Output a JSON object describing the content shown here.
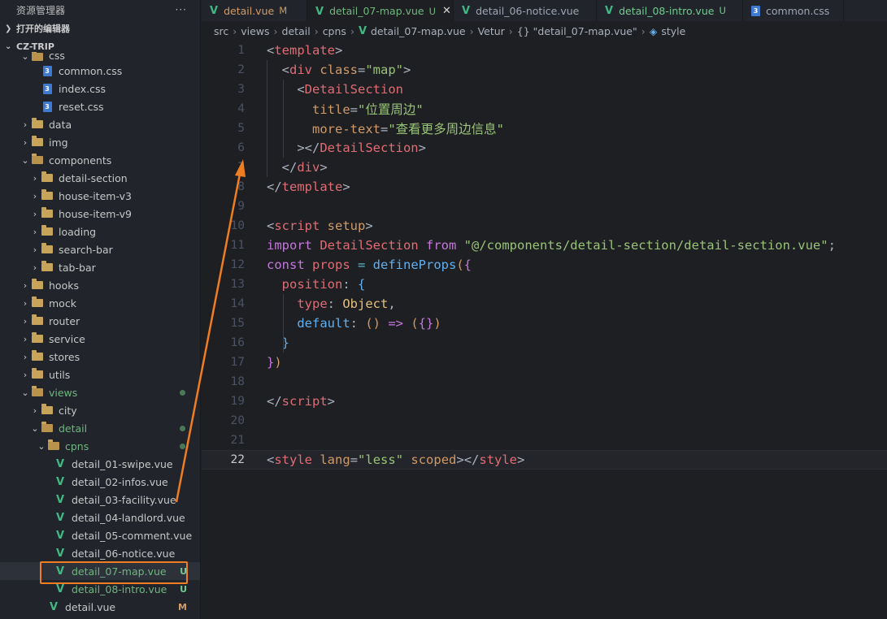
{
  "sidebar": {
    "title": "资源管理器",
    "more": "···",
    "open_editors": "打开的编辑器",
    "project": "CZ-TRIP",
    "tree": [
      {
        "label": "css",
        "kind": "folder-open",
        "depth": 1,
        "partial": true
      },
      {
        "label": "common.css",
        "kind": "css",
        "depth": 2
      },
      {
        "label": "index.css",
        "kind": "css",
        "depth": 2
      },
      {
        "label": "reset.css",
        "kind": "css",
        "depth": 2
      },
      {
        "label": "data",
        "kind": "folder",
        "depth": 1
      },
      {
        "label": "img",
        "kind": "folder",
        "depth": 1
      },
      {
        "label": "components",
        "kind": "folder-open",
        "depth": 1
      },
      {
        "label": "detail-section",
        "kind": "folder",
        "depth": 2
      },
      {
        "label": "house-item-v3",
        "kind": "folder",
        "depth": 2
      },
      {
        "label": "house-item-v9",
        "kind": "folder",
        "depth": 2
      },
      {
        "label": "loading",
        "kind": "folder",
        "depth": 2
      },
      {
        "label": "search-bar",
        "kind": "folder",
        "depth": 2
      },
      {
        "label": "tab-bar",
        "kind": "folder",
        "depth": 2
      },
      {
        "label": "hooks",
        "kind": "folder",
        "depth": 1
      },
      {
        "label": "mock",
        "kind": "folder",
        "depth": 1
      },
      {
        "label": "router",
        "kind": "folder",
        "depth": 1
      },
      {
        "label": "service",
        "kind": "folder",
        "depth": 1
      },
      {
        "label": "stores",
        "kind": "folder",
        "depth": 1
      },
      {
        "label": "utils",
        "kind": "folder",
        "depth": 1
      },
      {
        "label": "views",
        "kind": "folder-open",
        "depth": 1,
        "dot": true,
        "green": true
      },
      {
        "label": "city",
        "kind": "folder",
        "depth": 2
      },
      {
        "label": "detail",
        "kind": "folder-open",
        "depth": 2,
        "dot": true,
        "green": true
      },
      {
        "label": "cpns",
        "kind": "folder-open",
        "depth": 3,
        "dot": true,
        "green": true
      },
      {
        "label": "detail_01-swipe.vue",
        "kind": "vue",
        "depth": 4
      },
      {
        "label": "detail_02-infos.vue",
        "kind": "vue",
        "depth": 4
      },
      {
        "label": "detail_03-facility.vue",
        "kind": "vue",
        "depth": 4
      },
      {
        "label": "detail_04-landlord.vue",
        "kind": "vue",
        "depth": 4
      },
      {
        "label": "detail_05-comment.vue",
        "kind": "vue",
        "depth": 4
      },
      {
        "label": "detail_06-notice.vue",
        "kind": "vue",
        "depth": 4
      },
      {
        "label": "detail_07-map.vue",
        "kind": "vue",
        "depth": 4,
        "badge": "U",
        "green": true,
        "selected": true
      },
      {
        "label": "detail_08-intro.vue",
        "kind": "vue",
        "depth": 4,
        "badge": "U",
        "green": true
      },
      {
        "label": "detail.vue",
        "kind": "vue",
        "depth": 3,
        "badge": "M",
        "modified": true
      }
    ]
  },
  "tabs": [
    {
      "label": "detail.vue",
      "badge": "M",
      "kind": "vue",
      "state": "mod"
    },
    {
      "label": "detail_07-map.vue",
      "badge": "U",
      "kind": "vue",
      "state": "active",
      "close": "✕"
    },
    {
      "label": "detail_06-notice.vue",
      "badge": "",
      "kind": "vue",
      "state": "normal"
    },
    {
      "label": "detail_08-intro.vue",
      "badge": "U",
      "kind": "vue",
      "state": "untracked"
    },
    {
      "label": "common.css",
      "badge": "",
      "kind": "css",
      "state": "normal"
    }
  ],
  "breadcrumb": [
    "src",
    "views",
    "detail",
    "cpns",
    "detail_07-map.vue",
    "Vetur",
    "{} \"detail_07-map.vue\"",
    "style"
  ],
  "editor": {
    "current_line": 22,
    "lines": [
      [
        [
          "tk-br",
          "<"
        ],
        [
          "tk-tag",
          "template"
        ],
        [
          "tk-br",
          ">"
        ]
      ],
      [
        [
          "tk-br",
          "  <"
        ],
        [
          "tk-tag",
          "div"
        ],
        [
          "tk-attr",
          " class"
        ],
        [
          "tk-br",
          "="
        ],
        [
          "tk-str",
          "\"map\""
        ],
        [
          "tk-br",
          ">"
        ]
      ],
      [
        [
          "tk-br",
          "    <"
        ],
        [
          "tk-tag",
          "DetailSection"
        ]
      ],
      [
        [
          "tk-attr",
          "      title"
        ],
        [
          "tk-br",
          "="
        ],
        [
          "tk-str",
          "\"位置周边\""
        ]
      ],
      [
        [
          "tk-attr",
          "      more-text"
        ],
        [
          "tk-br",
          "="
        ],
        [
          "tk-str",
          "\"查看更多周边信息\""
        ]
      ],
      [
        [
          "tk-br",
          "    ></"
        ],
        [
          "tk-tag",
          "DetailSection"
        ],
        [
          "tk-br",
          ">"
        ]
      ],
      [
        [
          "tk-br",
          "  </"
        ],
        [
          "tk-tag",
          "div"
        ],
        [
          "tk-br",
          ">"
        ]
      ],
      [
        [
          "tk-br",
          "</"
        ],
        [
          "tk-tag",
          "template"
        ],
        [
          "tk-br",
          ">"
        ]
      ],
      [],
      [
        [
          "tk-br",
          "<"
        ],
        [
          "tk-tag",
          "script"
        ],
        [
          "tk-attr",
          " setup"
        ],
        [
          "tk-br",
          ">"
        ]
      ],
      [
        [
          "tk-kw",
          "import"
        ],
        [
          "tk-var",
          " DetailSection"
        ],
        [
          "tk-kw",
          " from"
        ],
        [
          "tk-str",
          " \"@/components/detail-section/detail-section.vue\""
        ],
        [
          "tk-punc",
          ";"
        ]
      ],
      [
        [
          "tk-const",
          "const"
        ],
        [
          "tk-var",
          " props"
        ],
        [
          "tk-op",
          " ="
        ],
        [
          "tk-fn",
          " defineProps"
        ],
        [
          "tk-brace1",
          "("
        ],
        [
          "tk-brace2",
          "{"
        ]
      ],
      [
        [
          "tk-prop",
          "  position"
        ],
        [
          "tk-punc",
          ":"
        ],
        [
          "tk-brace3",
          " {"
        ]
      ],
      [
        [
          "tk-prop",
          "    type"
        ],
        [
          "tk-punc",
          ":"
        ],
        [
          "tk-type",
          " Object"
        ],
        [
          "tk-punc",
          ","
        ]
      ],
      [
        [
          "tk-fn",
          "    default"
        ],
        [
          "tk-punc",
          ":"
        ],
        [
          "tk-brace1",
          " ()"
        ],
        [
          "tk-kw",
          " =>"
        ],
        [
          "tk-brace1",
          " ("
        ],
        [
          "tk-brace2",
          "{}"
        ],
        [
          "tk-brace1",
          ")"
        ]
      ],
      [
        [
          "tk-brace3",
          "  }"
        ]
      ],
      [
        [
          "tk-brace2",
          "}"
        ],
        [
          "tk-brace1",
          ")"
        ]
      ],
      [],
      [
        [
          "tk-br",
          "</"
        ],
        [
          "tk-tag",
          "script"
        ],
        [
          "tk-br",
          ">"
        ]
      ],
      [],
      [],
      [
        [
          "tk-br",
          "<"
        ],
        [
          "tk-tag",
          "style"
        ],
        [
          "tk-attr",
          " lang"
        ],
        [
          "tk-br",
          "="
        ],
        [
          "tk-str",
          "\"less\""
        ],
        [
          "tk-attr",
          " scoped"
        ],
        [
          "tk-br",
          "></"
        ],
        [
          "tk-tag",
          "style"
        ],
        [
          "tk-br",
          ">"
        ]
      ]
    ]
  },
  "colors": {
    "accent": "#ef7d22",
    "vue": "#42b883",
    "css": "#3f7ad1",
    "untracked": "#73c991",
    "modified": "#d19a66"
  }
}
